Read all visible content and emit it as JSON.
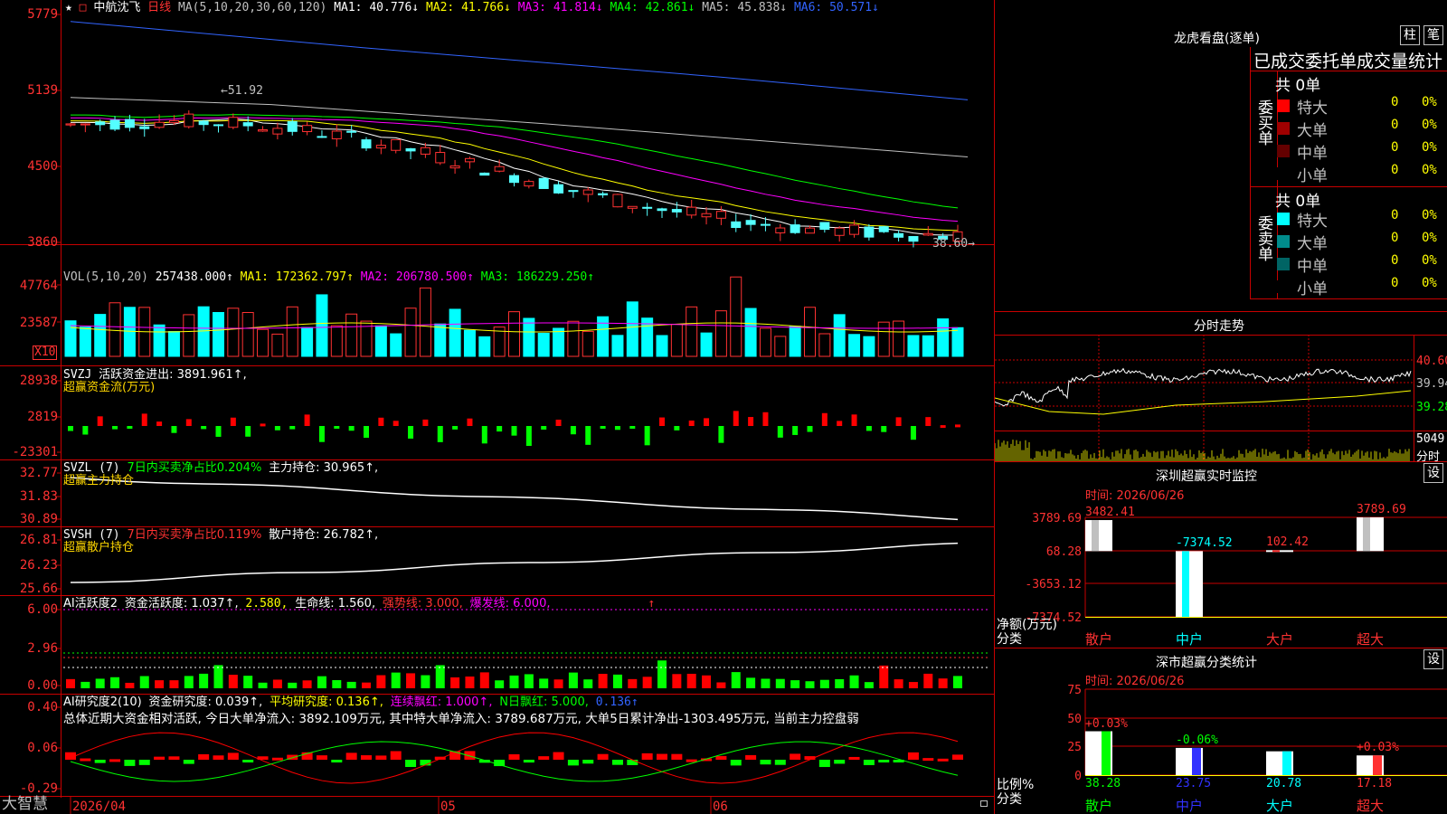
{
  "stock": {
    "star": "★",
    "name": "中航沈飞",
    "period": "日线",
    "period_marker": "□"
  },
  "price_panel": {
    "ma_spec": "MA(5,10,20,30,60,120)",
    "ma_labels": [
      "MA1: 40.776↓",
      "MA2: 41.766↓",
      "MA3: 41.814↓",
      "MA4: 42.861↓",
      "MA5: 45.838↓",
      "MA6: 50.571↓"
    ],
    "y_labels": [
      "5779",
      "5139",
      "4500",
      "3860"
    ],
    "high_label": "←51.92",
    "low_label": "38.60→",
    "colors": {
      "MA1": "#ffffff",
      "MA2": "#ffff00",
      "MA3": "#ff00ff",
      "MA4": "#00ff00",
      "MA5": "#c0c0c0",
      "MA6": "#3264ff"
    }
  },
  "vol_panel": {
    "spec": "VOL(5,10,20)",
    "value": "257438.000↑",
    "mas": [
      "MA1: 172362.797↑",
      "MA2: 206780.500↑",
      "MA3: 186229.250↑"
    ],
    "y_labels": [
      "47764",
      "23587"
    ],
    "unit": "X10"
  },
  "svzj_panel": {
    "name": "SVZJ",
    "text": "活跃资金进出: 3891.961↑,",
    "subtitle": "超赢资金流(万元)",
    "y_labels": [
      "28938",
      "2819",
      "-23301"
    ]
  },
  "svzl_panel": {
    "name": "SVZL (7)",
    "ratio": "7日内买卖净占比0.204%",
    "hold": "主力持仓: 30.965↑,",
    "subtitle": "超赢主力持仓",
    "y_labels": [
      "32.77",
      "31.83",
      "30.89"
    ]
  },
  "svsh_panel": {
    "name": "SVSH (7)",
    "ratio": "7日内买卖净占比0.119%",
    "hold": "散户持仓: 26.782↑,",
    "subtitle": "超赢散户持仓",
    "y_labels": [
      "26.81",
      "26.23",
      "25.66"
    ]
  },
  "ai_active": {
    "name": "AI活跃度2",
    "a": "资金活跃度: 1.037↑,",
    "b": "2.580,",
    "c": "生命线: 1.560,",
    "d": "强势线: 3.000,",
    "e": "爆发线: 6.000,",
    "arrow": "↑",
    "y_labels": [
      "6.00",
      "2.96",
      "0.00"
    ]
  },
  "ai_research": {
    "name": "AI研究度2(10)",
    "a": "资金研究度: 0.039↑,",
    "b": "平均研究度: 0.136↑,",
    "c": "连续飘红: 1.000↑,",
    "d": "N日飘红: 5.000,",
    "e": "0.136↑",
    "summary": "总体近期大资金相对活跃, 今日大单净流入: 3892.109万元, 其中特大单净流入: 3789.687万元, 大单5日累计净出-1303.495万元, 当前主力控盘弱",
    "y_labels": [
      "0.40",
      "0.06",
      "-0.29"
    ]
  },
  "x_axis": {
    "brand": "大智慧",
    "dates": [
      "2026/04",
      "05",
      "06"
    ]
  },
  "right": {
    "dragon_title": "龙虎看盘(逐单)",
    "btn_col": "柱",
    "btn_pen": "笔",
    "deal_title": "已成交委托单成交量统计",
    "buy": {
      "label": "委买单",
      "total": "共 0单",
      "rows": [
        {
          "name": "特大",
          "count": "0",
          "pct": "0%",
          "color": "#ff0000"
        },
        {
          "name": "大单",
          "count": "0",
          "pct": "0%",
          "color": "#a00000"
        },
        {
          "name": "中单",
          "count": "0",
          "pct": "0%",
          "color": "#640000"
        },
        {
          "name": "小单",
          "count": "0",
          "pct": "0%",
          "color": "#000000"
        }
      ]
    },
    "sell": {
      "label": "委卖单",
      "total": "共 0单",
      "rows": [
        {
          "name": "特大",
          "count": "0",
          "pct": "0%",
          "color": "#00ffff"
        },
        {
          "name": "大单",
          "count": "0",
          "pct": "0%",
          "color": "#008c8c"
        },
        {
          "name": "中单",
          "count": "0",
          "pct": "0%",
          "color": "#006464"
        },
        {
          "name": "小单",
          "count": "0",
          "pct": "0%",
          "color": "#000000"
        }
      ]
    },
    "intraday": {
      "title": "分时走势",
      "labels": [
        "40.60",
        "39.94",
        "39.28"
      ],
      "vol_label": "5049",
      "corner": "分时"
    },
    "monitor": {
      "title": "深圳超赢实时监控",
      "settings": "设",
      "time": "时间: 2026/06/26",
      "y_labels": [
        "3789.69",
        "68.28",
        "-3653.12",
        "-7374.52"
      ],
      "ylabel": "净额(万元)",
      "xlabel": "分类",
      "categories": [
        "散户",
        "中户",
        "大户",
        "超大"
      ],
      "values": [
        "3482.41",
        "-7374.52",
        "102.42",
        "3789.69"
      ]
    },
    "classify": {
      "title": "深市超赢分类统计",
      "settings": "设",
      "time": "时间: 2026/06/26",
      "y_labels": [
        "75",
        "50",
        "25",
        "0"
      ],
      "ylabel": "比例%",
      "xlabel": "分类",
      "categories": [
        "散户",
        "中户",
        "大户",
        "超大"
      ],
      "values": [
        "38.28",
        "23.75",
        "20.78",
        "17.18"
      ],
      "deltas": [
        "+0.03%",
        "-0.06%",
        "",
        "+0.03%"
      ]
    }
  },
  "chart_data": [
    {
      "type": "bar",
      "title": "深圳超赢实时监控",
      "ylabel": "净额(万元)",
      "xlabel": "分类",
      "categories": [
        "散户",
        "中户",
        "大户",
        "超大"
      ],
      "values": [
        3482.41,
        -7374.52,
        102.42,
        3789.69
      ],
      "ylim": [
        -7374.52,
        3789.69
      ]
    },
    {
      "type": "bar",
      "title": "深市超赢分类统计",
      "ylabel": "比例%",
      "xlabel": "分类",
      "categories": [
        "散户",
        "中户",
        "大户",
        "超大"
      ],
      "values": [
        38.28,
        23.75,
        20.78,
        17.18
      ],
      "ylim": [
        0,
        75
      ]
    }
  ]
}
